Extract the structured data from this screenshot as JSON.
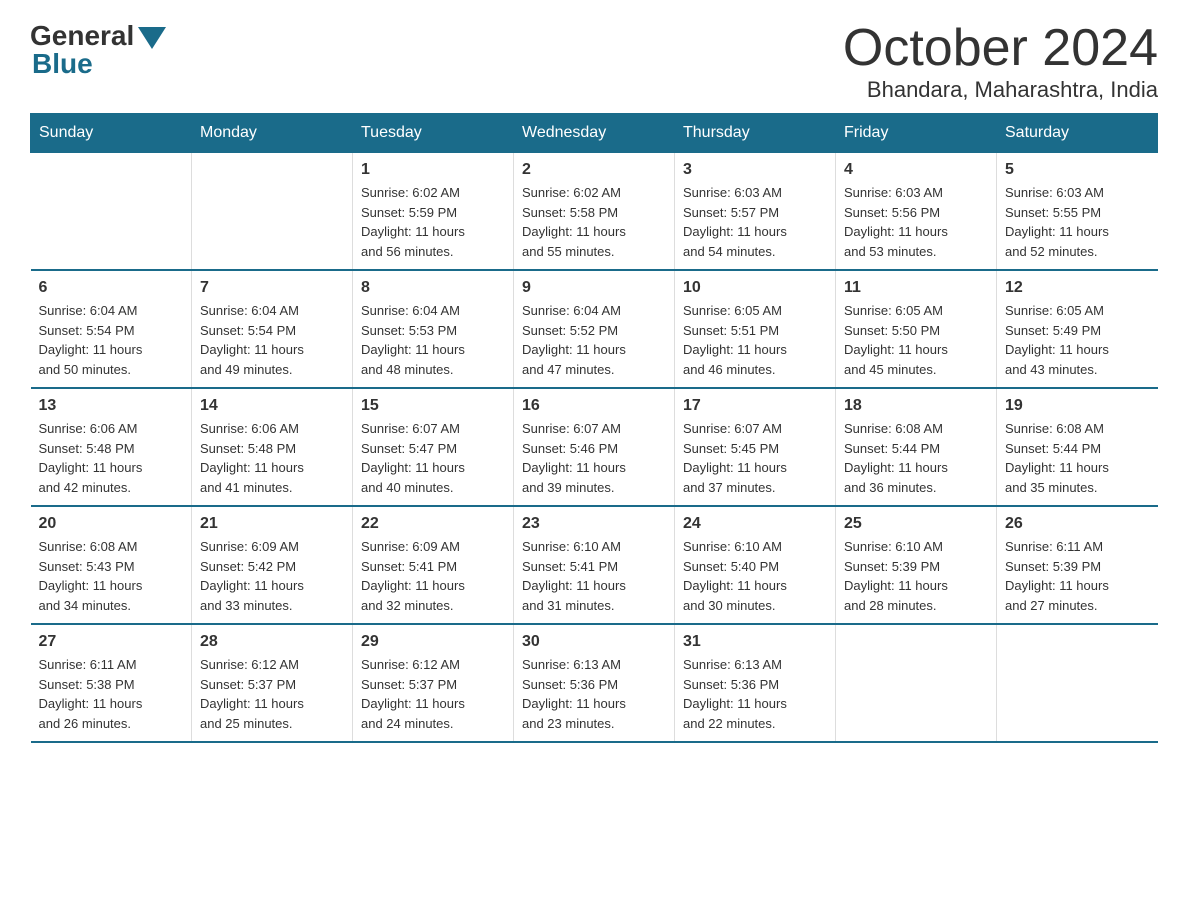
{
  "header": {
    "logo_general": "General",
    "logo_blue": "Blue",
    "month": "October 2024",
    "location": "Bhandara, Maharashtra, India"
  },
  "days_of_week": [
    "Sunday",
    "Monday",
    "Tuesday",
    "Wednesday",
    "Thursday",
    "Friday",
    "Saturday"
  ],
  "weeks": [
    [
      {
        "day": "",
        "info": ""
      },
      {
        "day": "",
        "info": ""
      },
      {
        "day": "1",
        "info": "Sunrise: 6:02 AM\nSunset: 5:59 PM\nDaylight: 11 hours\nand 56 minutes."
      },
      {
        "day": "2",
        "info": "Sunrise: 6:02 AM\nSunset: 5:58 PM\nDaylight: 11 hours\nand 55 minutes."
      },
      {
        "day": "3",
        "info": "Sunrise: 6:03 AM\nSunset: 5:57 PM\nDaylight: 11 hours\nand 54 minutes."
      },
      {
        "day": "4",
        "info": "Sunrise: 6:03 AM\nSunset: 5:56 PM\nDaylight: 11 hours\nand 53 minutes."
      },
      {
        "day": "5",
        "info": "Sunrise: 6:03 AM\nSunset: 5:55 PM\nDaylight: 11 hours\nand 52 minutes."
      }
    ],
    [
      {
        "day": "6",
        "info": "Sunrise: 6:04 AM\nSunset: 5:54 PM\nDaylight: 11 hours\nand 50 minutes."
      },
      {
        "day": "7",
        "info": "Sunrise: 6:04 AM\nSunset: 5:54 PM\nDaylight: 11 hours\nand 49 minutes."
      },
      {
        "day": "8",
        "info": "Sunrise: 6:04 AM\nSunset: 5:53 PM\nDaylight: 11 hours\nand 48 minutes."
      },
      {
        "day": "9",
        "info": "Sunrise: 6:04 AM\nSunset: 5:52 PM\nDaylight: 11 hours\nand 47 minutes."
      },
      {
        "day": "10",
        "info": "Sunrise: 6:05 AM\nSunset: 5:51 PM\nDaylight: 11 hours\nand 46 minutes."
      },
      {
        "day": "11",
        "info": "Sunrise: 6:05 AM\nSunset: 5:50 PM\nDaylight: 11 hours\nand 45 minutes."
      },
      {
        "day": "12",
        "info": "Sunrise: 6:05 AM\nSunset: 5:49 PM\nDaylight: 11 hours\nand 43 minutes."
      }
    ],
    [
      {
        "day": "13",
        "info": "Sunrise: 6:06 AM\nSunset: 5:48 PM\nDaylight: 11 hours\nand 42 minutes."
      },
      {
        "day": "14",
        "info": "Sunrise: 6:06 AM\nSunset: 5:48 PM\nDaylight: 11 hours\nand 41 minutes."
      },
      {
        "day": "15",
        "info": "Sunrise: 6:07 AM\nSunset: 5:47 PM\nDaylight: 11 hours\nand 40 minutes."
      },
      {
        "day": "16",
        "info": "Sunrise: 6:07 AM\nSunset: 5:46 PM\nDaylight: 11 hours\nand 39 minutes."
      },
      {
        "day": "17",
        "info": "Sunrise: 6:07 AM\nSunset: 5:45 PM\nDaylight: 11 hours\nand 37 minutes."
      },
      {
        "day": "18",
        "info": "Sunrise: 6:08 AM\nSunset: 5:44 PM\nDaylight: 11 hours\nand 36 minutes."
      },
      {
        "day": "19",
        "info": "Sunrise: 6:08 AM\nSunset: 5:44 PM\nDaylight: 11 hours\nand 35 minutes."
      }
    ],
    [
      {
        "day": "20",
        "info": "Sunrise: 6:08 AM\nSunset: 5:43 PM\nDaylight: 11 hours\nand 34 minutes."
      },
      {
        "day": "21",
        "info": "Sunrise: 6:09 AM\nSunset: 5:42 PM\nDaylight: 11 hours\nand 33 minutes."
      },
      {
        "day": "22",
        "info": "Sunrise: 6:09 AM\nSunset: 5:41 PM\nDaylight: 11 hours\nand 32 minutes."
      },
      {
        "day": "23",
        "info": "Sunrise: 6:10 AM\nSunset: 5:41 PM\nDaylight: 11 hours\nand 31 minutes."
      },
      {
        "day": "24",
        "info": "Sunrise: 6:10 AM\nSunset: 5:40 PM\nDaylight: 11 hours\nand 30 minutes."
      },
      {
        "day": "25",
        "info": "Sunrise: 6:10 AM\nSunset: 5:39 PM\nDaylight: 11 hours\nand 28 minutes."
      },
      {
        "day": "26",
        "info": "Sunrise: 6:11 AM\nSunset: 5:39 PM\nDaylight: 11 hours\nand 27 minutes."
      }
    ],
    [
      {
        "day": "27",
        "info": "Sunrise: 6:11 AM\nSunset: 5:38 PM\nDaylight: 11 hours\nand 26 minutes."
      },
      {
        "day": "28",
        "info": "Sunrise: 6:12 AM\nSunset: 5:37 PM\nDaylight: 11 hours\nand 25 minutes."
      },
      {
        "day": "29",
        "info": "Sunrise: 6:12 AM\nSunset: 5:37 PM\nDaylight: 11 hours\nand 24 minutes."
      },
      {
        "day": "30",
        "info": "Sunrise: 6:13 AM\nSunset: 5:36 PM\nDaylight: 11 hours\nand 23 minutes."
      },
      {
        "day": "31",
        "info": "Sunrise: 6:13 AM\nSunset: 5:36 PM\nDaylight: 11 hours\nand 22 minutes."
      },
      {
        "day": "",
        "info": ""
      },
      {
        "day": "",
        "info": ""
      }
    ]
  ]
}
